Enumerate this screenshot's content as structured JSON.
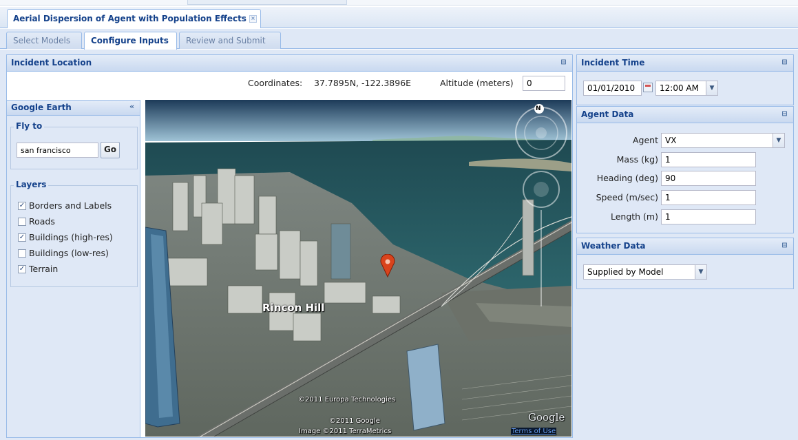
{
  "app": {
    "document_tab": "Aerial Dispersion of Agent with Population Effects",
    "close_glyph": "×"
  },
  "wizard_steps": [
    {
      "label": "Select Models",
      "active": false
    },
    {
      "label": "Configure Inputs",
      "active": true
    },
    {
      "label": "Review and Submit",
      "active": false
    }
  ],
  "incident_location": {
    "title": "Incident Location",
    "coordinates_label": "Coordinates:",
    "coordinates_value": "37.7895N, -122.3896E",
    "altitude_label": "Altitude (meters)",
    "altitude_value": "0"
  },
  "google_earth": {
    "title": "Google Earth",
    "collapse_glyph": "«",
    "fly_to_legend": "Fly to",
    "fly_to_value": "san francisco",
    "go_label": "Go",
    "layers_legend": "Layers",
    "layers": [
      {
        "label": "Borders and Labels",
        "checked": true
      },
      {
        "label": "Roads",
        "checked": false
      },
      {
        "label": "Buildings (high-res)",
        "checked": true
      },
      {
        "label": "Buildings (low-res)",
        "checked": false
      },
      {
        "label": "Terrain",
        "checked": true
      }
    ]
  },
  "map": {
    "place_label": "Rincon Hill",
    "compass_label": "N",
    "credit_1": "©2011 Europa Technologies",
    "credit_2": "©2011 Google",
    "credit_3": "Image ©2011 TerraMetrics",
    "logo": "Google",
    "terms_link": "Terms of Use"
  },
  "incident_time": {
    "title": "Incident Time",
    "date_value": "01/01/2010",
    "time_value": "12:00 AM"
  },
  "agent_data": {
    "title": "Agent Data",
    "fields": [
      {
        "label": "Agent",
        "value": "VX"
      },
      {
        "label": "Mass (kg)",
        "value": "1"
      },
      {
        "label": "Heading (deg)",
        "value": "90"
      },
      {
        "label": "Speed (m/sec)",
        "value": "1"
      },
      {
        "label": "Length (m)",
        "value": "1"
      }
    ]
  },
  "weather_data": {
    "title": "Weather Data",
    "source_value": "Supplied by Model"
  },
  "icons": {
    "panel_tool": "restore-window-icon",
    "calendar": "calendar-icon",
    "dropdown": "chevron-down-icon",
    "marker": "map-marker-icon"
  },
  "colors": {
    "header_text": "#15428b",
    "border": "#99bbe8",
    "panel_bg": "#dfe8f6",
    "marker": "#d9431c"
  }
}
